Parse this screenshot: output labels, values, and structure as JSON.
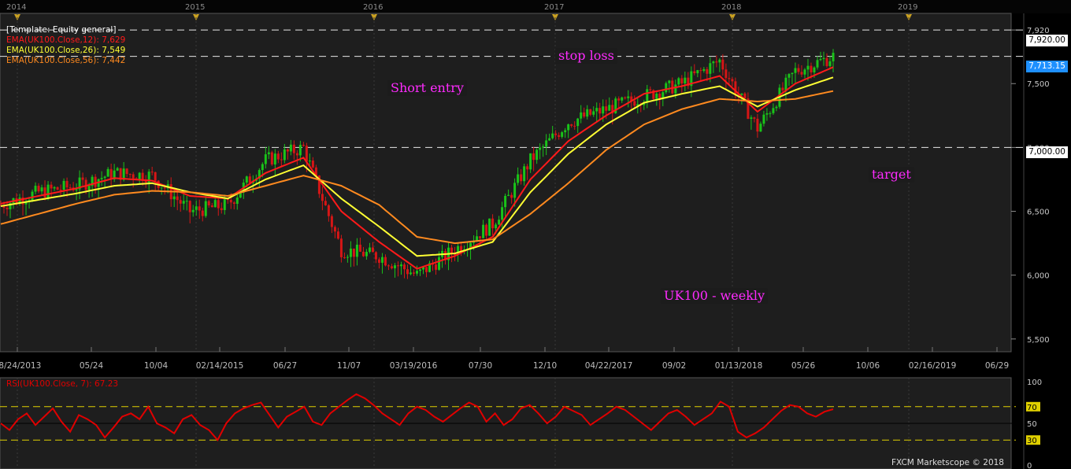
{
  "colors": {
    "background": "#1e1e1e",
    "candle_up": "#19c419",
    "candle_down": "#d51616",
    "ema12": "#ff1a1a",
    "ema26": "#ffff33",
    "ema56": "#ff8a1f",
    "rsi": "#e00000",
    "annotation": "#ff2bff"
  },
  "header": {
    "years": [
      "2014",
      "2015",
      "2016",
      "2017",
      "2018",
      "2019"
    ]
  },
  "legend": {
    "template": "[Template: Equity general]",
    "ema12": "EMA(UK100.Close,12): 7,629",
    "ema26": "EMA(UK100.Close,26): 7,549",
    "ema56": "EMA(UK100.Close,56): 7,442"
  },
  "annotations": {
    "stop_loss": "stop loss",
    "short_entry": "Short entry",
    "target": "target",
    "chart_title": "UK100 - weekly"
  },
  "levels": {
    "stop_label": "7,920.00",
    "price_label": "7,713.15",
    "target_label": "7,000.00"
  },
  "rsi": {
    "legend": "RSI(UK100.Close, 7): 67.23",
    "ticks": [
      "100",
      "70",
      "50",
      "30",
      "0"
    ]
  },
  "footer": "FXCM Marketscope © 2018",
  "chart_data": [
    {
      "type": "candlestick",
      "title": "UK100 - weekly",
      "x_dates": [
        "2013-08-24",
        "2013-11-16",
        "2014-02-08",
        "2014-05-03",
        "2014-07-26",
        "2014-10-18",
        "2015-01-10",
        "2015-04-04",
        "2015-06-27",
        "2015-09-19",
        "2015-12-12",
        "2016-03-05",
        "2016-05-28",
        "2016-08-20",
        "2016-11-12",
        "2017-02-04",
        "2017-04-29",
        "2017-07-22",
        "2017-10-14",
        "2018-01-06",
        "2018-03-31",
        "2018-06-23",
        "2018-08-18"
      ],
      "close": [
        6550,
        6650,
        6700,
        6800,
        6780,
        6500,
        6550,
        6900,
        7000,
        6200,
        6150,
        6000,
        6200,
        6400,
        6900,
        7200,
        7300,
        7400,
        7500,
        7680,
        7150,
        7600,
        7713
      ],
      "series": [
        {
          "name": "EMA(UK100.Close,12)",
          "values": [
            6560,
            6620,
            6680,
            6760,
            6740,
            6620,
            6600,
            6800,
            6920,
            6500,
            6260,
            6050,
            6150,
            6300,
            6750,
            7050,
            7250,
            7420,
            7480,
            7560,
            7280,
            7500,
            7629
          ]
        },
        {
          "name": "EMA(UK100.Close,26)",
          "values": [
            6540,
            6590,
            6640,
            6700,
            6720,
            6650,
            6600,
            6750,
            6860,
            6600,
            6380,
            6150,
            6170,
            6260,
            6650,
            6950,
            7180,
            7350,
            7420,
            7480,
            7320,
            7450,
            7549
          ]
        },
        {
          "name": "EMA(UK100.Close,56)",
          "values": [
            6400,
            6480,
            6560,
            6630,
            6660,
            6650,
            6620,
            6700,
            6780,
            6700,
            6550,
            6300,
            6250,
            6280,
            6480,
            6720,
            6980,
            7180,
            7300,
            7380,
            7360,
            7380,
            7442
          ]
        }
      ],
      "horizontal_lines": [
        7920,
        7713.15,
        7000
      ],
      "ylim": [
        5400,
        8050
      ],
      "y_ticks": [
        "7,920",
        "7,500",
        "7,000",
        "6,500",
        "6,000",
        "5,500"
      ],
      "x_tick_labels": [
        "08/24/2013",
        "05/24",
        "10/04",
        "02/14/2015",
        "06/27",
        "11/07",
        "03/19/2016",
        "07/30",
        "12/10",
        "04/22/2017",
        "09/02",
        "01/13/2018",
        "05/26",
        "10/06",
        "02/16/2019",
        "06/29"
      ],
      "grid": true
    },
    {
      "type": "line",
      "title": "RSI(UK100.Close, 7): 67.23",
      "series": [
        {
          "name": "RSI(UK100.Close, 7)",
          "values": [
            50,
            42,
            55,
            62,
            48,
            58,
            68,
            52,
            40,
            60,
            55,
            48,
            33,
            45,
            58,
            62,
            55,
            70,
            50,
            45,
            38,
            55,
            60,
            48,
            42,
            30,
            50,
            62,
            68,
            72,
            75,
            60,
            45,
            58,
            64,
            70,
            52,
            48,
            62,
            70,
            78,
            85,
            80,
            72,
            62,
            55,
            48,
            62,
            70,
            66,
            58,
            52,
            60,
            68,
            75,
            70,
            52,
            62,
            48,
            55,
            68,
            72,
            62,
            50,
            58,
            70,
            65,
            60,
            48,
            55,
            62,
            70,
            66,
            58,
            50,
            42,
            52,
            62,
            66,
            58,
            48,
            55,
            62,
            76,
            70,
            40,
            33,
            38,
            45,
            55,
            65,
            72,
            70,
            62,
            58,
            64,
            67
          ]
        }
      ],
      "ylim": [
        0,
        100
      ],
      "reference_lines": [
        70,
        50,
        30
      ]
    }
  ]
}
